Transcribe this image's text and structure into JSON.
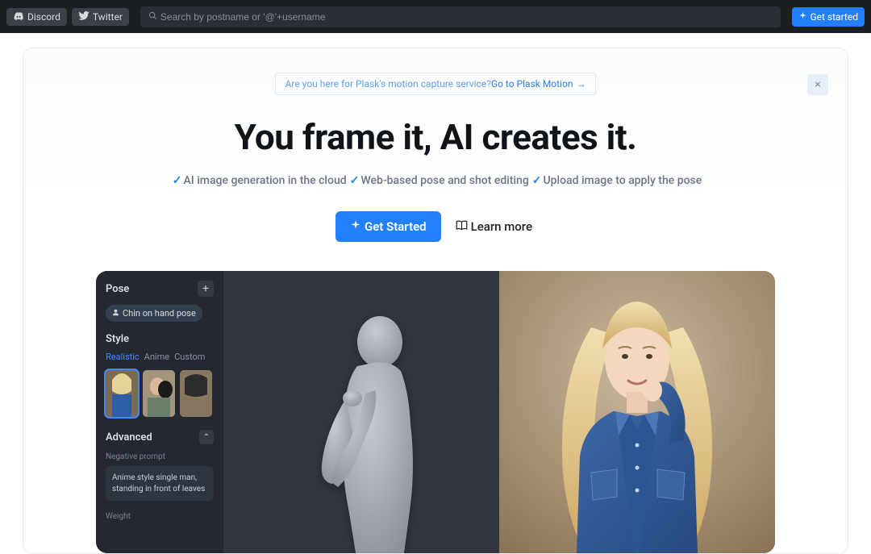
{
  "topbar": {
    "discord_label": "Discord",
    "twitter_label": "Twitter",
    "search_placeholder": "Search by postname or '@'+username",
    "get_started_label": "Get started"
  },
  "banner": {
    "question": "Are you here for Plask's motion capture service?",
    "link_text": "Go to Plask Motion",
    "arrow": "→"
  },
  "hero": {
    "headline": "You frame it, AI creates it.",
    "features": {
      "f1": "AI image generation in the cloud",
      "f2": "Web-based pose and shot editing",
      "f3": "Upload image to apply the pose"
    },
    "cta_primary": "Get Started",
    "cta_secondary": "Learn more"
  },
  "preview": {
    "pose": {
      "title": "Pose",
      "chip": "Chin on hand pose"
    },
    "style": {
      "title": "Style",
      "tabs": {
        "t1": "Realistic",
        "t2": "Anime",
        "t3": "Custom"
      }
    },
    "advanced": {
      "title": "Advanced",
      "neg_label": "Negative prompt",
      "neg_value": "Anime style single man, standing in front of leaves",
      "weight_label": "Weight"
    }
  }
}
